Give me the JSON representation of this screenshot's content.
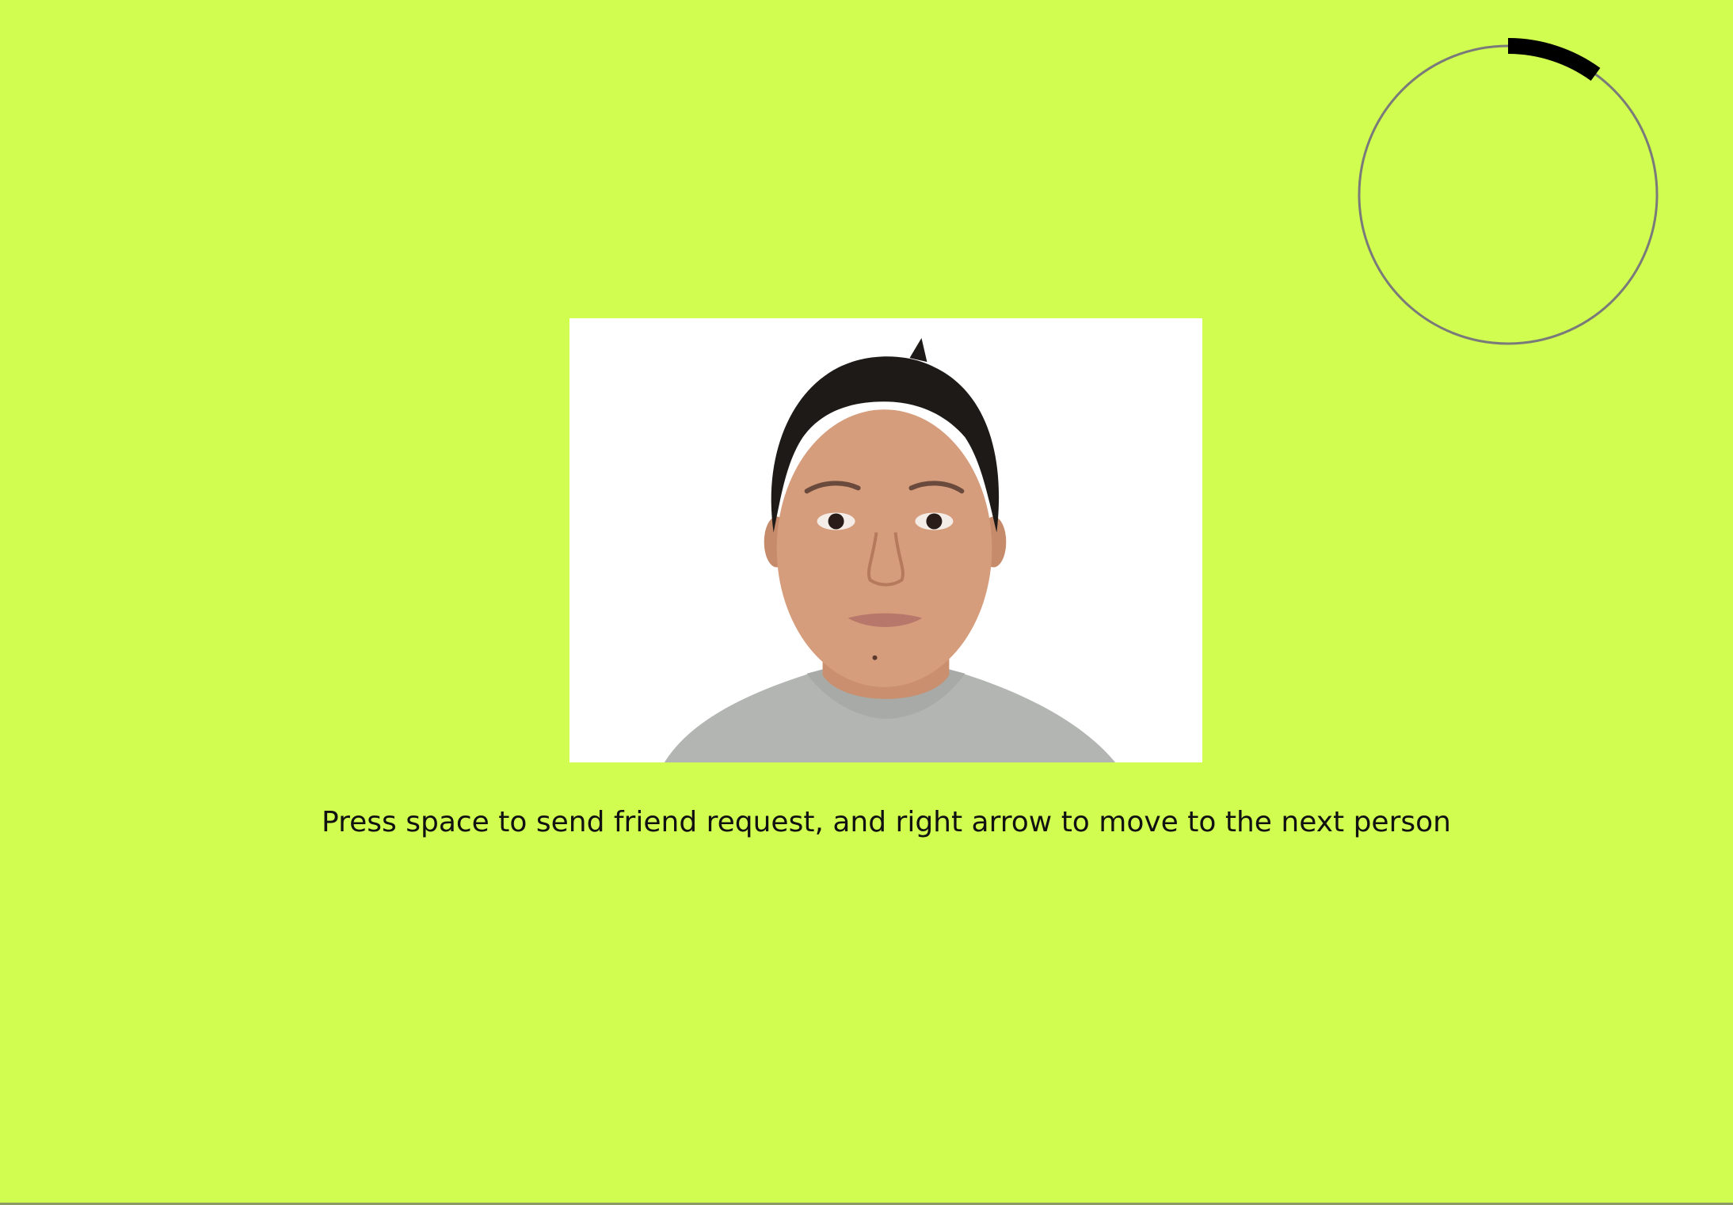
{
  "screen": {
    "background_color": "#d0fd50"
  },
  "timer": {
    "progress_fraction": 0.1,
    "track_color": "#7a7a7a",
    "progress_color": "#000000"
  },
  "photo": {
    "subject": "portrait-photo",
    "background_color": "#ffffff"
  },
  "instruction": {
    "text": "Press space to send friend request, and right arrow to move to the next person"
  }
}
